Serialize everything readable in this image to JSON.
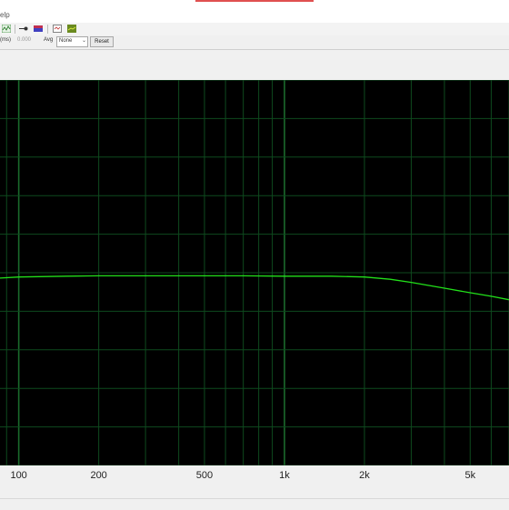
{
  "menubar": {
    "fragment": "elp"
  },
  "toolbar": {
    "icons": [
      "waveform-icon",
      "playback-icon",
      "color-bars-icon",
      "window-icon",
      "spectrum-icon"
    ]
  },
  "options": {
    "ms_label": "(ms)",
    "ms_value": "0.000",
    "avg_label": "Avg",
    "avg_value": "None",
    "reset_label": "Reset"
  },
  "chart_data": {
    "type": "line",
    "x_scale": "log",
    "xlim": [
      85,
      7000
    ],
    "x_ticks": [
      {
        "value": 100,
        "label": "100"
      },
      {
        "value": 200,
        "label": "200"
      },
      {
        "value": 500,
        "label": "500"
      },
      {
        "value": 1000,
        "label": "1k"
      },
      {
        "value": 2000,
        "label": "2k"
      },
      {
        "value": 5000,
        "label": "5k"
      }
    ],
    "ylim": [
      0,
      100
    ],
    "grid": true,
    "colors": {
      "background": "#000000",
      "grid": "#0e4a1e",
      "grid_major": "#1a6a2c",
      "trace": "#22e01a"
    },
    "series": [
      {
        "x": [
          85,
          100,
          150,
          200,
          300,
          500,
          700,
          1000,
          1500,
          2000,
          2500,
          3000,
          4000,
          5000,
          6000,
          7000
        ],
        "y": [
          48.6,
          48.9,
          49.1,
          49.2,
          49.2,
          49.2,
          49.2,
          49.1,
          49.1,
          48.9,
          48.3,
          47.5,
          46.0,
          44.8,
          43.9,
          43.0
        ]
      }
    ]
  }
}
